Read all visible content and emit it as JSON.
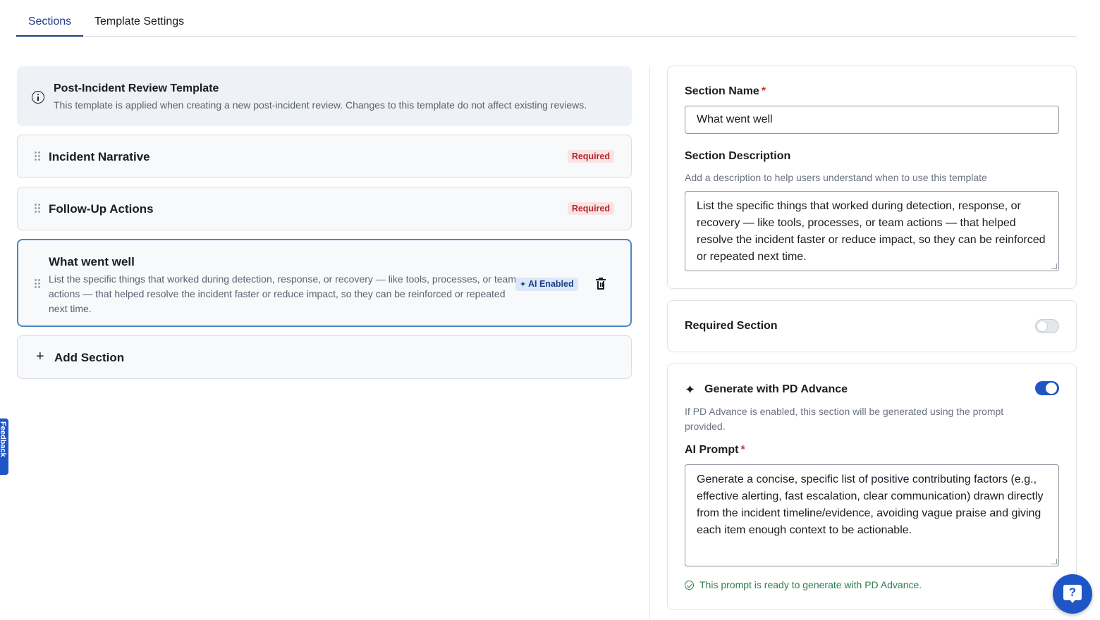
{
  "tabs": [
    {
      "label": "Sections",
      "active": true
    },
    {
      "label": "Template Settings",
      "active": false
    }
  ],
  "info": {
    "title": "Post-Incident Review Template",
    "text": "This template is applied when creating a new post-incident review. Changes to this template do not affect existing reviews.",
    "icon": "info-icon"
  },
  "sections": [
    {
      "title": "Incident Narrative",
      "badge": "Required"
    },
    {
      "title": "Follow-Up Actions",
      "badge": "Required"
    },
    {
      "title": "What went well",
      "description": "List the specific things that worked during detection, response, or recovery — like tools, processes, or team actions — that helped resolve the incident faster or reduce impact, so they can be reinforced or repeated next time.",
      "badge": "AI Enabled",
      "selected": true
    }
  ],
  "add_section": {
    "label": "Add Section",
    "icon": "plus-icon"
  },
  "editor": {
    "name_label": "Section Name",
    "name_value": "What went well",
    "description_label": "Section Description",
    "description_help": "Add a description to help users understand when to use this template",
    "description_value": "List the specific things that worked during detection, response, or recovery — like tools, processes, or team actions — that helped resolve the incident faster or reduce impact, so they can be reinforced or repeated next time.",
    "required_label": "Required Section",
    "required_on": false,
    "generate_label": "Generate with PD Advance",
    "generate_on": true,
    "generate_help": "If PD Advance is enabled, this section will be generated using the prompt provided.",
    "prompt_label": "AI Prompt",
    "prompt_value": "Generate a concise, specific list of positive contributing factors (e.g., effective alerting, fast escalation, clear communication) drawn directly from the incident timeline/evidence, avoiding vague praise and giving each item enough context to be actionable.",
    "ready_text": "This prompt is ready to generate with PD Advance.",
    "required_marker": "*"
  },
  "feedback_label": "Feedback",
  "help_button": {
    "label": "?"
  },
  "colors": {
    "accent": "#1e56c8",
    "tab_active": "#1d3f86",
    "required_badge": "#b3262f",
    "success": "#2e7d4f"
  }
}
